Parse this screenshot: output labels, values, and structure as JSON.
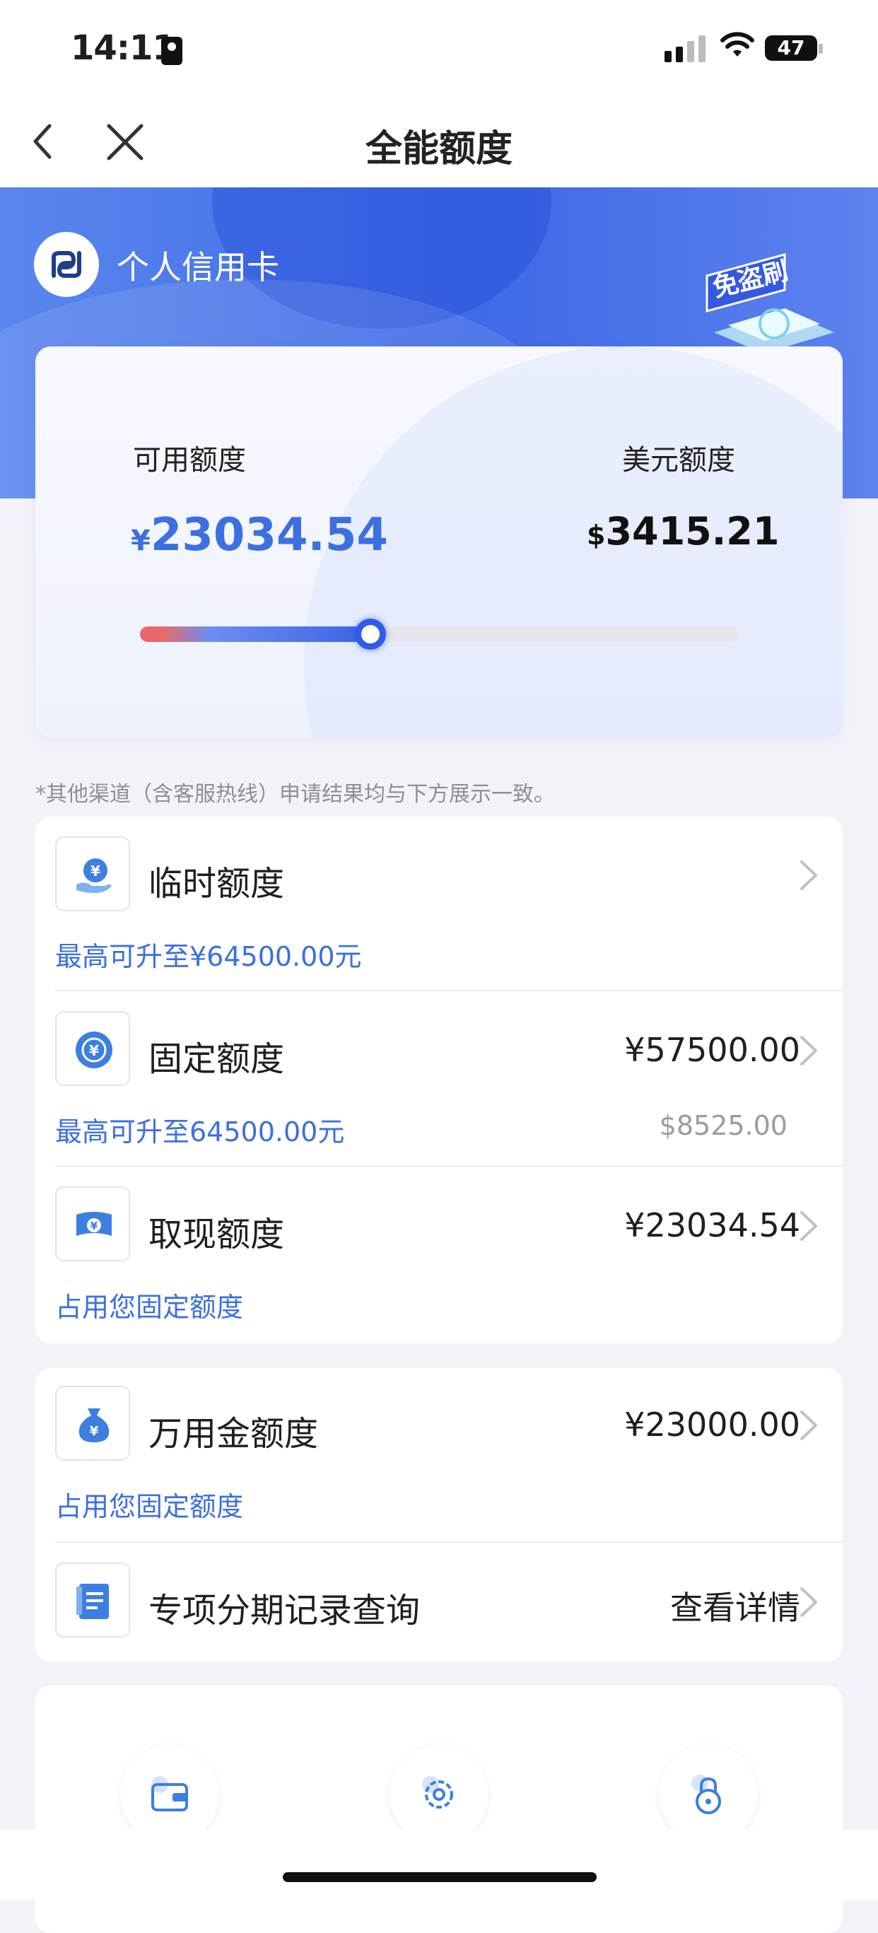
{
  "status_bar": {
    "time": "14:11",
    "battery": "47"
  },
  "nav": {
    "title": "全能额度"
  },
  "header": {
    "card_label": "个人信用卡",
    "badge_text": "免盗刷"
  },
  "summary": {
    "available_label": "可用额度",
    "available_currency": "¥",
    "available_value": "23034.54",
    "usd_label": "美元额度",
    "usd_currency": "$",
    "usd_value": "3415.21",
    "usage_fraction": 0.385
  },
  "note": "*其他渠道（含客服热线）申请结果均与下方展示一致。",
  "limits": [
    {
      "title": "临时额度",
      "value": "",
      "sub": "最高可升至¥64500.00元",
      "sub_right": ""
    },
    {
      "title": "固定额度",
      "value": "¥57500.00",
      "sub": "最高可升至64500.00元",
      "sub_right": "$8525.00"
    },
    {
      "title": "取现额度",
      "value": "¥23034.54",
      "sub": "占用您固定额度",
      "sub_right": ""
    }
  ],
  "others": [
    {
      "title": "万用金额度",
      "value": "¥23000.00",
      "sub": "占用您固定额度"
    },
    {
      "title": "专项分期记录查询",
      "value": "查看详情"
    }
  ],
  "icons": [
    "back-icon",
    "close-icon",
    "wallet-icon",
    "settings-icon",
    "lock-icon"
  ],
  "colors": {
    "accent": "#3c6fe0",
    "header": "#4a74ea",
    "slider_start": "#e8666a"
  }
}
